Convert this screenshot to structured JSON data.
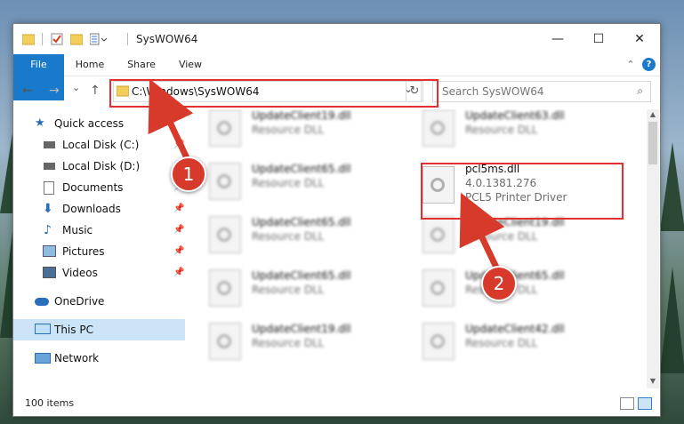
{
  "window": {
    "title": "SysWOW64",
    "minimize": "—",
    "maximize": "☐",
    "close": "✕"
  },
  "ribbon": {
    "tabs": [
      "File",
      "Home",
      "Share",
      "View"
    ],
    "collapse": "⌃",
    "help": "?"
  },
  "nav": {
    "back": "←",
    "forward": "→",
    "recent": "⌄",
    "up": "↑",
    "address": "C:\\Windows\\SysWOW64",
    "address_dropdown": "⌄",
    "refresh": "↻",
    "search_placeholder": "Search SysWOW64",
    "search_icon": "⌕"
  },
  "sidebar": {
    "items": [
      {
        "label": "Quick access",
        "icon": "star-icon",
        "pinned": false
      },
      {
        "label": "Local Disk (C:)",
        "icon": "drive-icon",
        "pinned": true
      },
      {
        "label": "Local Disk (D:)",
        "icon": "drive-icon",
        "pinned": true
      },
      {
        "label": "Documents",
        "icon": "documents-icon",
        "pinned": true
      },
      {
        "label": "Downloads",
        "icon": "download-icon",
        "pinned": true
      },
      {
        "label": "Music",
        "icon": "music-icon",
        "pinned": true
      },
      {
        "label": "Pictures",
        "icon": "pictures-icon",
        "pinned": true
      },
      {
        "label": "Videos",
        "icon": "videos-icon",
        "pinned": true
      },
      {
        "label": "OneDrive",
        "icon": "cloud-icon",
        "pinned": false
      },
      {
        "label": "This PC",
        "icon": "computer-icon",
        "pinned": false,
        "selected": true
      },
      {
        "label": "Network",
        "icon": "network-icon",
        "pinned": false
      }
    ],
    "pin_glyph": "📌"
  },
  "files": {
    "col1": [
      {
        "name": "UpdateClient19.dll",
        "desc": "Resource DLL"
      },
      {
        "name": "UpdateClient65.dll",
        "desc": "Resource DLL"
      },
      {
        "name": "UpdateClient65.dll",
        "desc": "Resource DLL"
      },
      {
        "name": "UpdateClient65.dll",
        "desc": "Resource DLL"
      },
      {
        "name": "UpdateClient19.dll",
        "desc": "Resource DLL"
      }
    ],
    "col2": [
      {
        "name": "UpdateClient63.dll",
        "desc": "Resource DLL"
      },
      {
        "name": "UpdateClient19.dll",
        "desc": "Resource DLL"
      },
      {
        "name": "UpdateClient65.dll",
        "desc": "Resource DLL"
      },
      {
        "name": "UpdateClient42.dll",
        "desc": "Resource DLL"
      }
    ],
    "featured": {
      "name": "pcl5ms.dll",
      "version": "4.0.1381.276",
      "desc": "PCL5 Printer Driver"
    }
  },
  "status": {
    "count": "100 items"
  },
  "annotations": {
    "badge1": "1",
    "badge2": "2",
    "color": "#e03030"
  }
}
